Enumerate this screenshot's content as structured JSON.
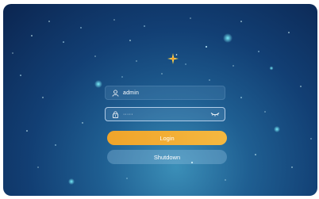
{
  "login": {
    "username_value": "admin",
    "password_value": "·····",
    "login_label": "Login",
    "shutdown_label": "Shutdown"
  },
  "icons": {
    "logo": "star-logo-icon",
    "user": "user-icon",
    "password": "lock-icon",
    "visibility": "eye-closed-icon"
  },
  "colors": {
    "background_top": "#0b2550",
    "background_glow": "#3b8fb8",
    "login_button": "#f0a42a",
    "shutdown_button": "#7fb0d0"
  }
}
